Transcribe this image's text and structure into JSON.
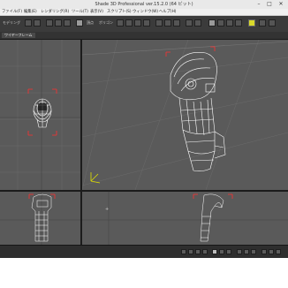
{
  "app": {
    "title": "Shade 3D Professional ver.15.2.0 (64 ビット)"
  },
  "window_controls": {
    "minimize": "–",
    "maximize": "□",
    "close": "✕"
  },
  "menu": {
    "items": [
      {
        "label": "ファイル(F)"
      },
      {
        "label": "編集(E)"
      },
      {
        "label": "レンダリング(R)"
      },
      {
        "label": "ツール(T)"
      },
      {
        "label": "表示(V)"
      },
      {
        "label": "スクリプト(S)"
      },
      {
        "label": "ウィンドウ(W)"
      },
      {
        "label": "ヘルプ(H)"
      }
    ]
  },
  "toolbar": {
    "mode_label": "モデリング",
    "active_tool": "select-icon",
    "options": {
      "vertex": "頂点",
      "polygon": "ポリゴン"
    }
  },
  "subbar": {
    "view_label": "ワイヤーフレーム"
  },
  "viewports": [
    {
      "name": "top",
      "render": "wireframe"
    },
    {
      "name": "perspective",
      "render": "wireframe"
    },
    {
      "name": "front",
      "render": "wireframe"
    },
    {
      "name": "right",
      "render": "wireframe"
    }
  ],
  "colors": {
    "viewport_bg": "#5a5a5a",
    "wireframe": "#ffffff",
    "selection": "#ff3030",
    "highlight": "#d9d92a"
  }
}
